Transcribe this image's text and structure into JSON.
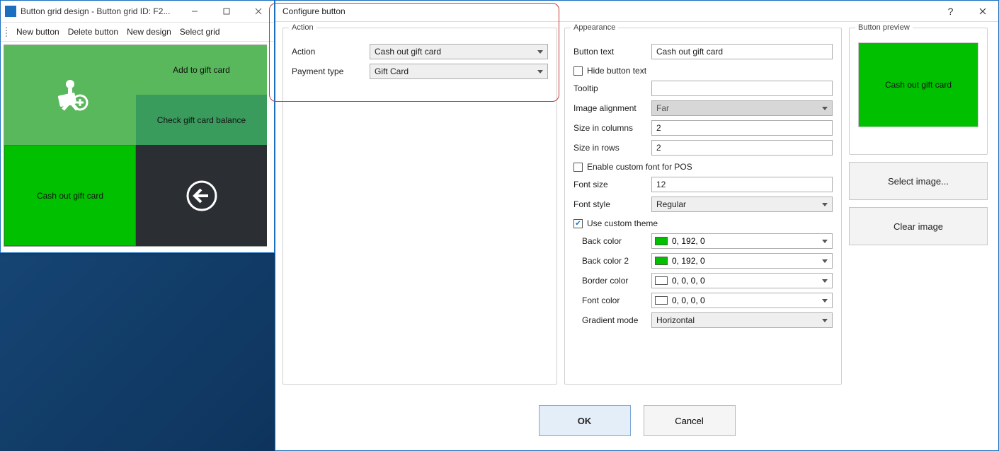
{
  "grid_window": {
    "title": "Button grid design - Button grid ID: F2...",
    "toolbar": {
      "new_button": "New button",
      "delete_button": "Delete button",
      "new_design": "New design",
      "select_grid": "Select grid"
    },
    "buttons": {
      "add_to_gift_card": "Add to gift card",
      "check_balance": "Check gift card balance",
      "cash_out": "Cash out gift card"
    }
  },
  "dialog": {
    "title": "Configure button",
    "action_group": "Action",
    "appearance_group": "Appearance",
    "preview_group": "Button preview",
    "labels": {
      "action": "Action",
      "payment_type": "Payment type",
      "button_text": "Button text",
      "hide_button_text": "Hide button text",
      "tooltip": "Tooltip",
      "image_alignment": "Image alignment",
      "size_cols": "Size in columns",
      "size_rows": "Size in rows",
      "enable_custom_font": "Enable custom font for POS",
      "font_size": "Font size",
      "font_style": "Font style",
      "use_custom_theme": "Use custom theme",
      "back_color": "Back color",
      "back_color2": "Back color 2",
      "border_color": "Border color",
      "font_color": "Font color",
      "gradient_mode": "Gradient mode"
    },
    "values": {
      "action": "Cash out gift card",
      "payment_type": "Gift Card",
      "button_text": "Cash out gift card",
      "hide_button_text_checked": false,
      "tooltip": "",
      "image_alignment": "Far",
      "size_cols": "2",
      "size_rows": "2",
      "enable_custom_font_checked": false,
      "font_size": "12",
      "font_style": "Regular",
      "use_custom_theme_checked": true,
      "back_color": "0, 192, 0",
      "back_color2": "0, 192, 0",
      "border_color": "0, 0, 0, 0",
      "font_color": "0, 0, 0, 0",
      "gradient_mode": "Horizontal"
    },
    "side_buttons": {
      "select_image": "Select image...",
      "clear_image": "Clear image"
    },
    "footer": {
      "ok": "OK",
      "cancel": "Cancel"
    },
    "preview_text": "Cash out gift card"
  },
  "colors": {
    "back_color_hex": "#00c000",
    "back_color2_hex": "#00c000",
    "border_color_hex": "#ffffff",
    "font_color_hex": "#ffffff"
  }
}
